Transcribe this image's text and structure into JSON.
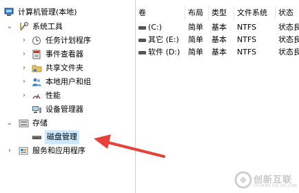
{
  "tree": {
    "root": "计算机管理(本地)",
    "system_tools": "系统工具",
    "task_scheduler": "任务计划程序",
    "event_viewer": "事件查看器",
    "shared_folders": "共享文件夹",
    "local_users": "本地用户和组",
    "performance": "性能",
    "device_manager": "设备管理器",
    "storage": "存储",
    "disk_management": "磁盘管理",
    "services_apps": "服务和应用程序"
  },
  "columns": [
    "卷",
    "布局",
    "类型",
    "文件系统",
    "状态"
  ],
  "volumes": [
    {
      "name": "(C:)",
      "layout": "简单",
      "type": "基本",
      "fs": "NTFS",
      "status": "状态良"
    },
    {
      "name": "其它 (E:)",
      "layout": "简单",
      "type": "基本",
      "fs": "NTFS",
      "status": "状态良"
    },
    {
      "name": "软件 (D:)",
      "layout": "简单",
      "type": "基本",
      "fs": "NTFS",
      "status": "状态良"
    }
  ],
  "watermark": {
    "text": "创新互联",
    "sub": "CHUANG XIN HU LIAN"
  },
  "colors": {
    "selection": "#cce8ff",
    "arrow": "#e8413a"
  },
  "icons": {
    "root": "computer-management-icon",
    "system_tools": "tools-icon",
    "task_scheduler": "clock-icon",
    "event_viewer": "event-viewer-icon",
    "shared_folders": "shared-folder-icon",
    "local_users": "users-icon",
    "performance": "performance-icon",
    "device_manager": "device-manager-icon",
    "storage": "storage-icon",
    "disk_management": "disk-icon",
    "services_apps": "services-icon"
  }
}
